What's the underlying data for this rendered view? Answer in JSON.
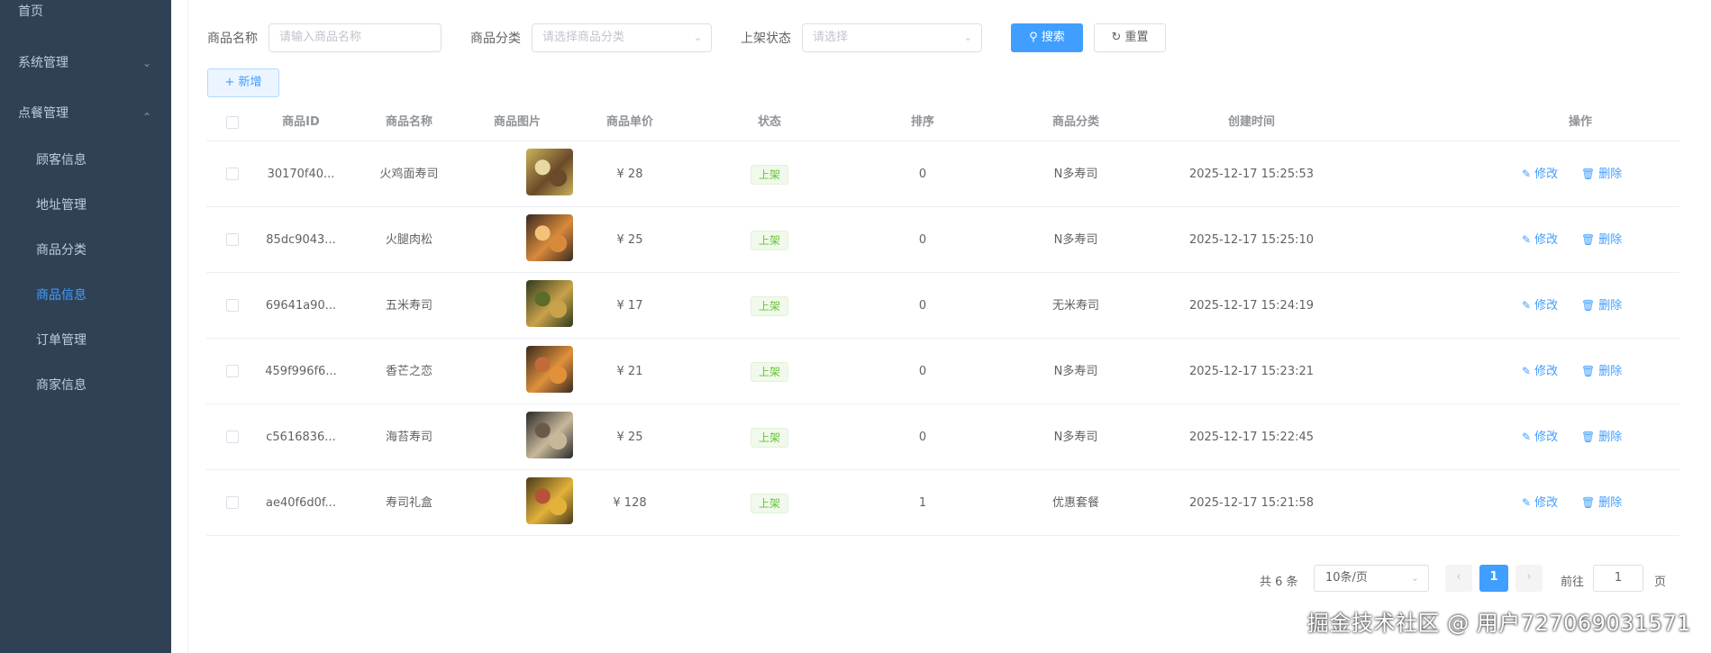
{
  "sidebar": {
    "items": [
      {
        "label": "首页",
        "level": "top"
      },
      {
        "label": "系统管理",
        "level": "top",
        "chevron": "chevron-down"
      },
      {
        "label": "点餐管理",
        "level": "top",
        "chevron": "chevron-up"
      },
      {
        "label": "顾客信息",
        "level": "sub"
      },
      {
        "label": "地址管理",
        "level": "sub"
      },
      {
        "label": "商品分类",
        "level": "sub"
      },
      {
        "label": "商品信息",
        "level": "sub",
        "active": true
      },
      {
        "label": "订单管理",
        "level": "sub"
      },
      {
        "label": "商家信息",
        "level": "sub"
      }
    ]
  },
  "search": {
    "name_label": "商品名称",
    "name_placeholder": "请输入商品名称",
    "category_label": "商品分类",
    "category_placeholder": "请选择商品分类",
    "status_label": "上架状态",
    "status_placeholder": "请选择",
    "search_button": "搜索",
    "reset_button": "重置"
  },
  "toolbar": {
    "add_button": "新增"
  },
  "table": {
    "headers": [
      "商品ID",
      "商品名称",
      "商品图片",
      "商品单价",
      "状态",
      "排序",
      "商品分类",
      "创建时间",
      "操作"
    ],
    "edit_label": "修改",
    "delete_label": "删除",
    "rows": [
      {
        "id": "30170f40...",
        "name": "火鸡面寿司",
        "price": "¥ 28",
        "status": "上架",
        "sort": "0",
        "category": "N多寿司",
        "created": "2025-12-17 15:25:53",
        "img_colors": [
          "#c9b35a",
          "#6b4a2a",
          "#e8d9a0"
        ]
      },
      {
        "id": "85dc9043...",
        "name": "火腿肉松",
        "price": "¥ 25",
        "status": "上架",
        "sort": "0",
        "category": "N多寿司",
        "created": "2025-12-17 15:25:10",
        "img_colors": [
          "#3a2a22",
          "#d88a3a",
          "#f2c27a"
        ]
      },
      {
        "id": "69641a90...",
        "name": "五米寿司",
        "price": "¥ 17",
        "status": "上架",
        "sort": "0",
        "category": "无米寿司",
        "created": "2025-12-17 15:24:19",
        "img_colors": [
          "#2e3a1e",
          "#c9a24a",
          "#5b6b2a"
        ]
      },
      {
        "id": "459f996f6...",
        "name": "香芒之恋",
        "price": "¥ 21",
        "status": "上架",
        "sort": "0",
        "category": "N多寿司",
        "created": "2025-12-17 15:23:21",
        "img_colors": [
          "#3a2a22",
          "#e0913a",
          "#c46a3a"
        ]
      },
      {
        "id": "c5616836...",
        "name": "海苔寿司",
        "price": "¥ 25",
        "status": "上架",
        "sort": "0",
        "category": "N多寿司",
        "created": "2025-12-17 15:22:45",
        "img_colors": [
          "#2a2a2a",
          "#c8b89a",
          "#6b5a4a"
        ]
      },
      {
        "id": "ae40f6d0f...",
        "name": "寿司礼盒",
        "price": "¥ 128",
        "status": "上架",
        "sort": "1",
        "category": "优惠套餐",
        "created": "2025-12-17 15:21:58",
        "img_colors": [
          "#4a3a1a",
          "#e2b23a",
          "#b8503a"
        ]
      }
    ]
  },
  "pagination": {
    "total": "共 6 条",
    "page_size": "10条/页",
    "current_page": "1",
    "goto_label": "前往",
    "goto_value": "1",
    "page_suffix": "页"
  },
  "watermark": "掘金技术社区 @ 用户727069031571",
  "colors": {
    "sidebar_bg": "#304156",
    "primary": "#409eff",
    "success": "#67c23a"
  }
}
